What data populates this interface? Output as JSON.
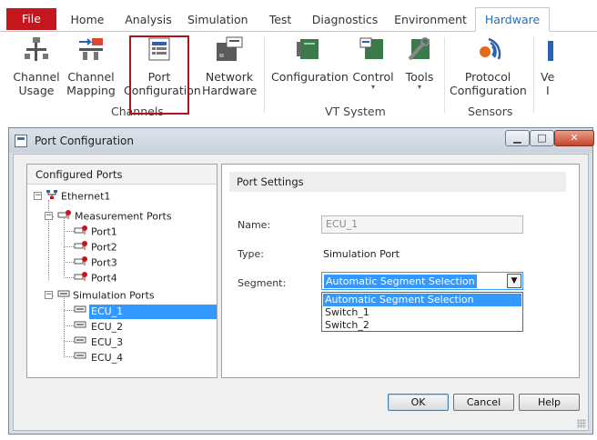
{
  "ribbon": {
    "tabs": [
      "File",
      "Home",
      "Analysis",
      "Simulation",
      "Test",
      "Diagnostics",
      "Environment",
      "Hardware"
    ],
    "active_tab": "Hardware",
    "buttons": {
      "channel_usage": [
        "Channel",
        "Usage"
      ],
      "channel_mapping": [
        "Channel",
        "Mapping"
      ],
      "port_configuration": [
        "Port",
        "Configuration"
      ],
      "network_hardware": [
        "Network",
        "Hardware"
      ],
      "configuration": "Configuration",
      "control": "Control",
      "tools": "Tools",
      "protocol_configuration": [
        "Protocol",
        "Configuration"
      ],
      "partial": [
        "Ve",
        "I"
      ]
    },
    "groups": {
      "channels": "Channels",
      "vt_system": "VT System",
      "sensors": "Sensors"
    }
  },
  "dialog": {
    "title": "Port Configuration",
    "tree": {
      "header": "Configured Ports",
      "root": "Ethernet1",
      "measurement_group": "Measurement Ports",
      "measurement_ports": [
        "Port1",
        "Port2",
        "Port3",
        "Port4"
      ],
      "simulation_group": "Simulation Ports",
      "simulation_ports": [
        "ECU_1",
        "ECU_2",
        "ECU_3",
        "ECU_4"
      ],
      "selected": "ECU_1"
    },
    "settings": {
      "header": "Port Settings",
      "name_label": "Name:",
      "name_value": "ECU_1",
      "type_label": "Type:",
      "type_value": "Simulation Port",
      "segment_label": "Segment:",
      "segment_value": "Automatic Segment Selection",
      "segment_options": [
        "Automatic Segment Selection",
        "Switch_1",
        "Switch_2"
      ]
    },
    "buttons": {
      "ok": "OK",
      "cancel": "Cancel",
      "help": "Help"
    }
  },
  "colors": {
    "file_tab": "#c4171d",
    "accent": "#1f6fb7",
    "selection": "#3399ff",
    "highlight_border": "#b0141c"
  }
}
